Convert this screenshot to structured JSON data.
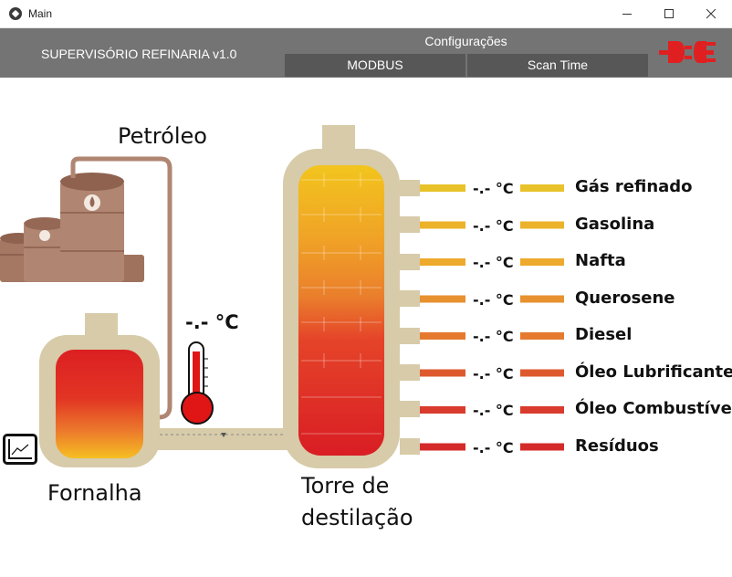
{
  "window": {
    "title": "Main"
  },
  "header": {
    "app_title": "SUPERVISÓRIO REFINARIA v1.0",
    "config_label": "Configurações",
    "modbus_button": "MODBUS",
    "scantime_button": "Scan Time"
  },
  "labels": {
    "petroleo": "Petróleo",
    "fornalha": "Fornalha",
    "torre_line1": "Torre de",
    "torre_line2": "destilação",
    "furnace_temp": "-.- °C"
  },
  "outputs": [
    {
      "name": "Gás refinado",
      "temp": "-.- °C",
      "color": "#e9c22a"
    },
    {
      "name": "Gasolina",
      "temp": "-.- °C",
      "color": "#ecb22a"
    },
    {
      "name": "Nafta",
      "temp": "-.- °C",
      "color": "#eeaa2c"
    },
    {
      "name": "Querosene",
      "temp": "-.- °C",
      "color": "#e8912f"
    },
    {
      "name": "Diesel",
      "temp": "-.- °C",
      "color": "#e57a2f"
    },
    {
      "name": "Óleo Lubrificante",
      "temp": "-.- °C",
      "color": "#de5a2e"
    },
    {
      "name": "Óleo Combustível",
      "temp": "-.- °C",
      "color": "#d93b2c"
    },
    {
      "name": "Resíduos",
      "temp": "-.- °C",
      "color": "#d52a2a"
    }
  ],
  "colors": {
    "header_bg": "#747474",
    "button_bg": "#575757",
    "vessel": "#d7cba9",
    "plug_red": "#e02020",
    "thermometer_red": "#e01515"
  }
}
